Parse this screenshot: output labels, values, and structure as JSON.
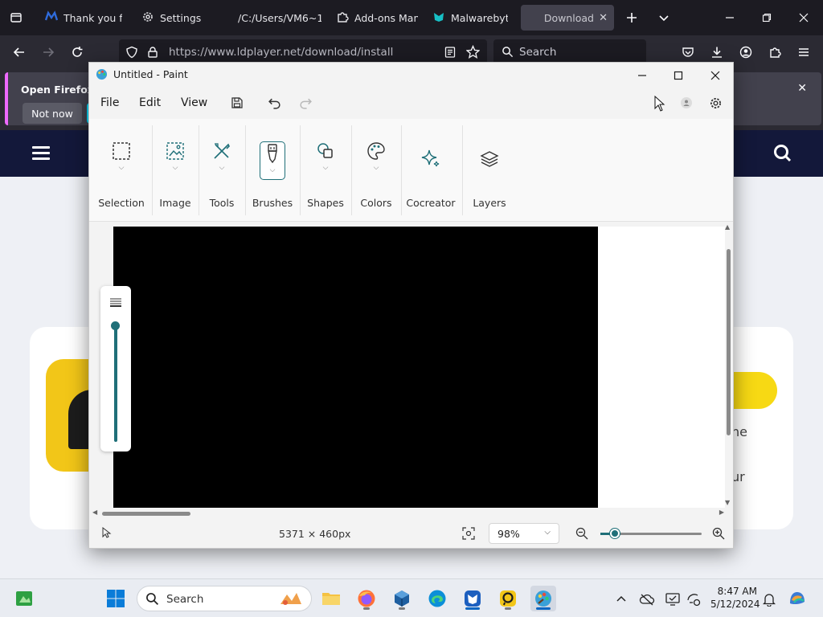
{
  "browser": {
    "tabs": [
      {
        "label": "Thank you for",
        "icon": "mail-icon"
      },
      {
        "label": "Settings",
        "icon": "gear-icon"
      },
      {
        "label": "/C:/Users/VM6~1/",
        "icon": "file-icon"
      },
      {
        "label": "Add-ons Mana",
        "icon": "puzzle-icon"
      },
      {
        "label": "Malwarebytes",
        "icon": "malwarebytes-icon"
      },
      {
        "label": "Download",
        "icon": "download-icon"
      }
    ],
    "url": "https://www.ldplayer.net/download/install",
    "search_placeholder": "Search",
    "notification": {
      "title": "Open Firefox ev",
      "dismiss_label": "Not now"
    }
  },
  "webpage": {
    "peek_text_1": "he",
    "peek_text_2": "ur"
  },
  "paint": {
    "title": "Untitled - Paint",
    "menu": [
      "File",
      "Edit",
      "View"
    ],
    "ribbon_groups": [
      "Selection",
      "Image",
      "Tools",
      "Brushes",
      "Shapes",
      "Colors",
      "Cocreator",
      "Layers"
    ],
    "selected_group": "Brushes",
    "canvas_dimensions": "5371 × 460px",
    "zoom": "98%",
    "canvas_color": "#000000",
    "accent_color": "#1f6f78"
  },
  "taskbar": {
    "search_placeholder": "Search",
    "time": "8:47 AM",
    "date": "5/12/2024"
  }
}
